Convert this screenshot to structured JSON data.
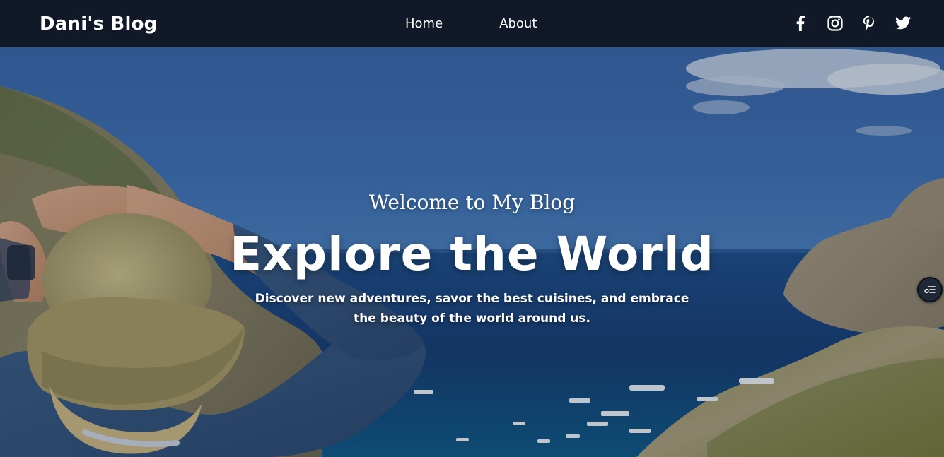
{
  "navbar": {
    "brand": "Dani's Blog",
    "links": [
      {
        "label": "Home"
      },
      {
        "label": "About"
      }
    ],
    "socials": [
      {
        "icon": "facebook-icon"
      },
      {
        "icon": "instagram-icon"
      },
      {
        "icon": "pinterest-icon"
      },
      {
        "icon": "twitter-icon"
      }
    ],
    "background_color": "#111827"
  },
  "hero": {
    "welcome": "Welcome to My Blog",
    "headline": "Explore the World",
    "tagline": "Discover new adventures, savor the best cuisines, and embrace the beauty of the world around us.",
    "background_image": "coastal-bay-traveler-photo"
  },
  "floating_button": {
    "icon": "toolbar-settings-icon"
  }
}
